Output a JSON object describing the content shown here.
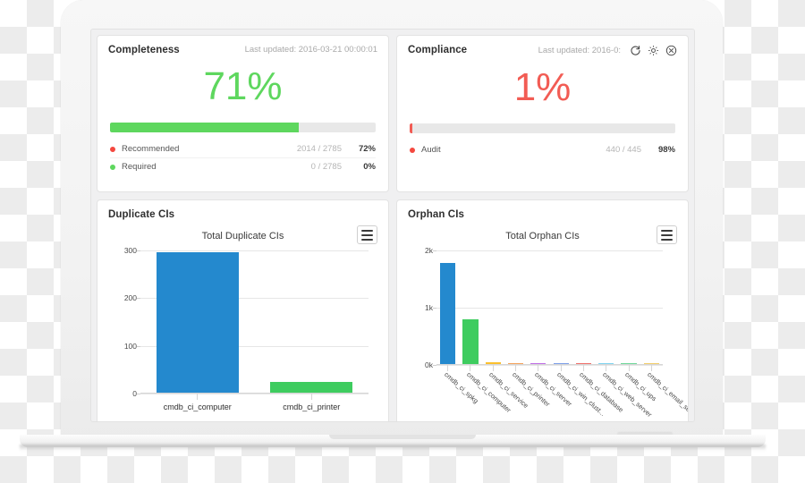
{
  "device": {
    "type": "laptop-mockup"
  },
  "panels": {
    "completeness": {
      "title": "Completeness",
      "meta": "Last updated: 2016-03-21 00:00:01",
      "percent_label": "71%",
      "percent_value": 71,
      "accent_color": "#5ed75e",
      "bar_fill_percent": 71,
      "legend": [
        {
          "dot_color": "#f4483f",
          "label": "Recommended",
          "count": "2014 / 2785",
          "percent": "72%"
        },
        {
          "dot_color": "#5ed75e",
          "label": "Required",
          "count": "0 / 2785",
          "percent": "0%"
        }
      ]
    },
    "compliance": {
      "title": "Compliance",
      "meta": "Last updated: 2016-0:",
      "percent_label": "1%",
      "percent_value": 1,
      "accent_color": "#f25c54",
      "bar_fill_percent": 1,
      "icons": [
        {
          "name": "refresh-icon",
          "glyph": "refresh"
        },
        {
          "name": "gear-icon",
          "glyph": "gear"
        },
        {
          "name": "close-icon",
          "glyph": "close"
        }
      ],
      "legend": [
        {
          "dot_color": "#f4483f",
          "label": "Audit",
          "count": "440 / 445",
          "percent": "98%"
        }
      ]
    },
    "duplicate": {
      "title": "Duplicate CIs",
      "menu_icon": "hamburger-menu-icon"
    },
    "orphan": {
      "title": "Orphan CIs",
      "menu_icon": "hamburger-menu-icon"
    }
  },
  "chart_data": [
    {
      "id": "duplicate",
      "type": "bar",
      "title": "Total Duplicate CIs",
      "categories": [
        "cmdb_ci_computer",
        "cmdb_ci_printer"
      ],
      "values": [
        297,
        25
      ],
      "colors": [
        "#2489ce",
        "#3ecc5f"
      ],
      "xlabel": "",
      "ylabel": "",
      "ylim": [
        0,
        300
      ],
      "yticks": [
        0,
        100,
        200,
        300
      ],
      "ytick_labels": [
        "0",
        "100",
        "200",
        "300"
      ],
      "grid": true,
      "legend": "none"
    },
    {
      "id": "orphan",
      "type": "bar",
      "title": "Total Orphan CIs",
      "categories": [
        "cmdb_ci_spkg",
        "cmdb_ci_computer",
        "cmdb_ci_service",
        "cmdb_ci_printer",
        "cmdb_ci_server",
        "cmdb_ci_win_clust...",
        "cmdb_ci_database",
        "cmdb_ci_web_server",
        "cmdb_ci_ups",
        "cmdb_ci_email_server"
      ],
      "values": [
        1780,
        800,
        40,
        30,
        28,
        26,
        24,
        22,
        20,
        18
      ],
      "colors": [
        "#2489ce",
        "#3ecc5f",
        "#fbc02d",
        "#f5a35c",
        "#c06ee6",
        "#7d9ee8",
        "#f0706a",
        "#7fd4f0",
        "#6fd99a",
        "#f3ce6a"
      ],
      "xlabel": "",
      "ylabel": "",
      "ylim": [
        0,
        2000
      ],
      "yticks": [
        0,
        1000,
        2000
      ],
      "ytick_labels": [
        "0k",
        "1k",
        "2k"
      ],
      "grid": true,
      "legend": "none"
    }
  ]
}
